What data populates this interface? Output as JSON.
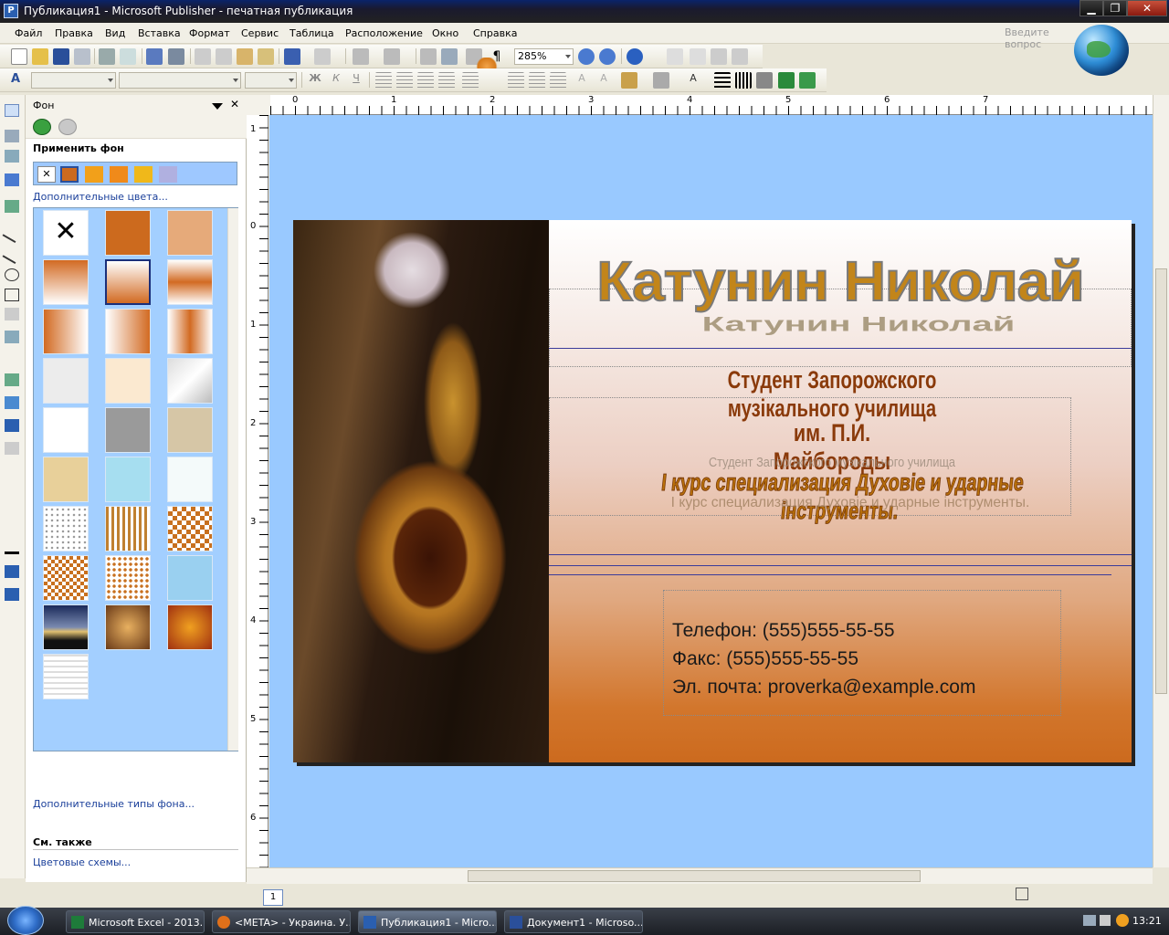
{
  "window": {
    "title": "Публикация1 - Microsoft Publisher - печатная публикация",
    "minimize": "▁",
    "restore": "❐",
    "close": "✕"
  },
  "menu": [
    "Файл",
    "Правка",
    "Вид",
    "Вставка",
    "Формат",
    "Сервис",
    "Таблица",
    "Расположение",
    "Окно",
    "Справка"
  ],
  "help_placeholder": "Введите вопрос",
  "toolbar": {
    "zoom": "285%",
    "pilcrow": "¶",
    "format_buttons": [
      "Ж",
      "К",
      "Ч"
    ]
  },
  "taskpane": {
    "title": "Фон",
    "apply_bg": "Применить фон",
    "more_colors": "Дополнительные цвета...",
    "more_types": "Дополнительные типы фона...",
    "see_also": "См. также",
    "color_schemes": "Цветовые схемы..."
  },
  "ruler": {
    "h": [
      "0",
      "1",
      "2",
      "3",
      "4",
      "5",
      "6",
      "7"
    ],
    "v": [
      "1",
      "0",
      "1",
      "2",
      "3",
      "4",
      "5",
      "6"
    ]
  },
  "card": {
    "name": "Катунин Николай",
    "line1": "Студент Запорожского музікального училища",
    "line2": "им. П.И. Майбороды",
    "line3": "І курс специализация Духовіе и ударные інструменты.",
    "phone": "Телефон: (555)555-55-55",
    "fax": "Факс: (555)555-55-55",
    "email": "Эл. почта: proverka@example.com"
  },
  "statusbar": {
    "page": "1"
  },
  "taskbar": {
    "tasks": [
      {
        "label": "Microsoft Excel - 2013...",
        "active": false
      },
      {
        "label": "<META> - Украина. У...",
        "active": false
      },
      {
        "label": "Публикация1 - Micro...",
        "active": true
      },
      {
        "label": "Документ1 - Microso...",
        "active": false
      }
    ],
    "time": "13:21"
  },
  "colors": {
    "canvas": "#99c9ff",
    "accent_orange": "#cc6a1e",
    "wordart_brown": "#8a3a0a"
  }
}
